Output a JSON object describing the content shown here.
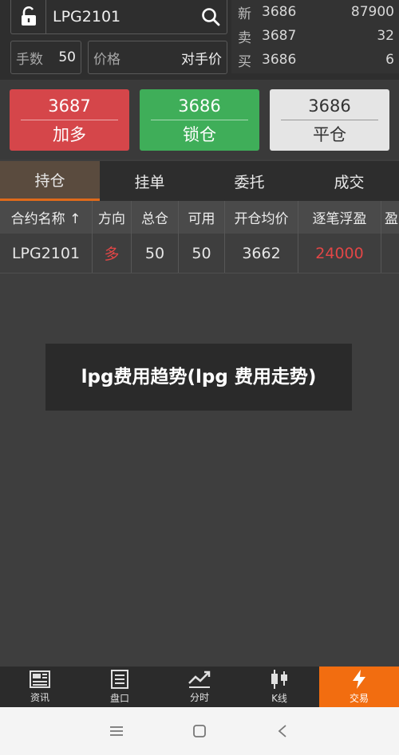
{
  "search": {
    "symbol": "LPG2101"
  },
  "order": {
    "qty_label": "手数",
    "qty_value": "50",
    "price_label": "价格",
    "price_value": "对手价"
  },
  "quote": {
    "rows": [
      {
        "key": "新",
        "price": "3686",
        "value": "87900"
      },
      {
        "key": "卖",
        "price": "3687",
        "value": "32"
      },
      {
        "key": "买",
        "price": "3686",
        "value": "6"
      }
    ]
  },
  "actions": {
    "buy": {
      "price": "3687",
      "label": "加多"
    },
    "sell": {
      "price": "3686",
      "label": "锁仓"
    },
    "close": {
      "price": "3686",
      "label": "平仓"
    }
  },
  "tabs": [
    "持仓",
    "挂单",
    "委托",
    "成交"
  ],
  "table": {
    "headers": [
      "合约名称 ↑",
      "方向",
      "总仓",
      "可用",
      "开仓均价",
      "逐笔浮盈",
      "盈"
    ],
    "rows": [
      [
        "LPG2101",
        "多",
        "50",
        "50",
        "3662",
        "24000",
        ""
      ]
    ]
  },
  "caption": "lpg费用趋势(lpg 费用走势)",
  "bottom_nav": [
    "资讯",
    "盘口",
    "分时",
    "K线",
    "交易"
  ],
  "colors": {
    "buy": "#d5464a",
    "sell": "#3fae59",
    "accent": "#f26d10",
    "profit": "#e24646"
  }
}
